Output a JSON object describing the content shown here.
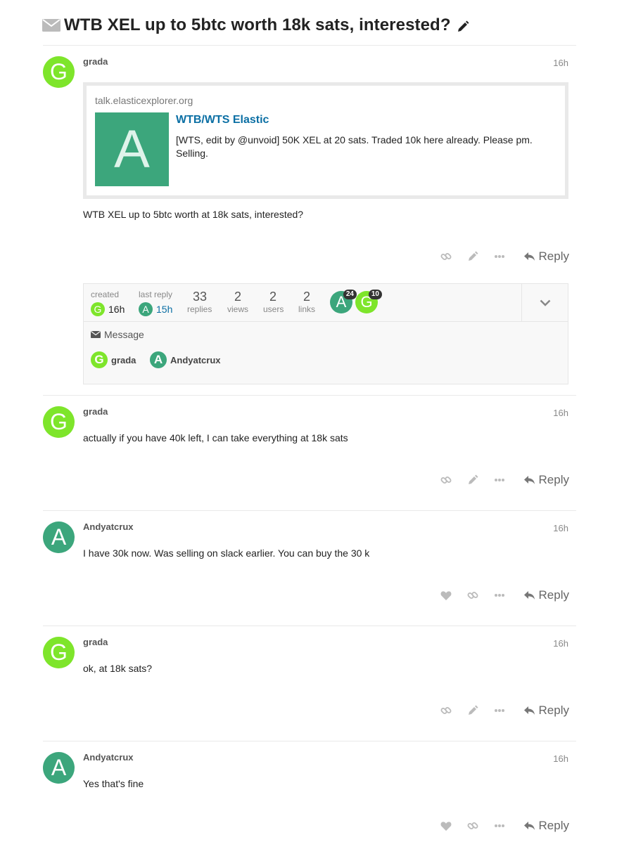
{
  "topic": {
    "title": "WTB XEL up to 5btc worth 18k sats, interested?",
    "icon": "envelope-icon",
    "edit_icon": "pencil-icon"
  },
  "colors": {
    "avatar_g": "#7ee52b",
    "avatar_a": "#3ca67c",
    "link": "#0b6fa4"
  },
  "posts": [
    {
      "avatar_letter": "G",
      "username": "grada",
      "time": "16h",
      "onebox": {
        "source": "talk.elasticexplorer.org",
        "thumb_letter": "A",
        "title": "WTB/WTS Elastic",
        "description": "[WTS, edit by @unvoid] 50K XEL at 20 sats. Traded 10k here already. Please pm. Selling."
      },
      "text": "WTB XEL up to 5btc worth at 18k sats, interested?",
      "reply_label": "Reply"
    },
    {
      "avatar_letter": "G",
      "username": "grada",
      "time": "16h",
      "text": "actually if you have 40k left, I can take everything at 18k sats",
      "reply_label": "Reply"
    },
    {
      "avatar_letter": "A",
      "username": "Andyatcrux",
      "time": "16h",
      "text": "I have 30k now. Was selling on slack earlier. You can buy the 30 k",
      "reply_label": "Reply"
    },
    {
      "avatar_letter": "G",
      "username": "grada",
      "time": "16h",
      "text": "ok, at 18k sats?",
      "reply_label": "Reply"
    },
    {
      "avatar_letter": "A",
      "username": "Andyatcrux",
      "time": "16h",
      "text": "Yes that's fine",
      "reply_label": "Reply"
    }
  ],
  "summary": {
    "created_label": "created",
    "created_avatar": "G",
    "created_time": "16h",
    "last_reply_label": "last reply",
    "last_reply_avatar": "A",
    "last_reply_time": "15h",
    "replies": "33",
    "replies_label": "replies",
    "views": "2",
    "views_label": "views",
    "users": "2",
    "users_label": "users",
    "links": "2",
    "links_label": "links",
    "participants": [
      {
        "letter": "A",
        "count": "24"
      },
      {
        "letter": "G",
        "count": "10"
      }
    ],
    "message_label": "Message",
    "message_users": [
      {
        "letter": "G",
        "name": "grada"
      },
      {
        "letter": "A",
        "name": "Andyatcrux"
      }
    ]
  }
}
